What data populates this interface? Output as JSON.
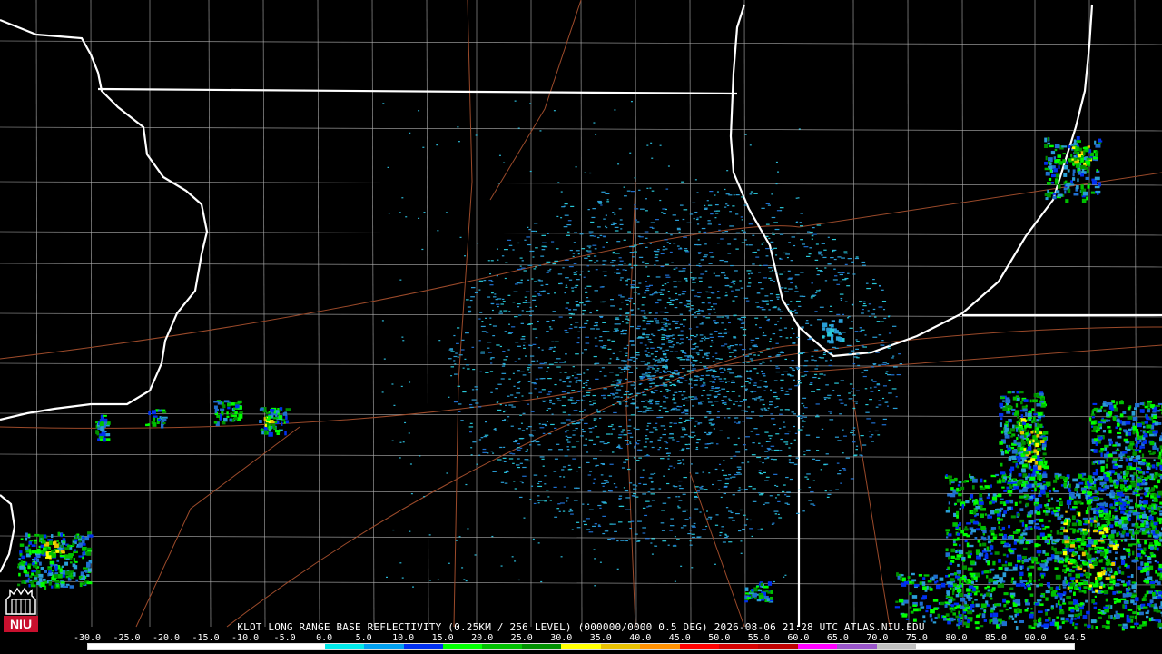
{
  "caption": {
    "radar": "KLOT LONG RANGE BASE REFLECTIVITY",
    "resolution": "(0.25KM / 256 LEVEL)",
    "volume": "(000000/0000 0.5 DEG)",
    "timestamp": "2026-08-06 21:28 UTC",
    "source": "ATLAS.NIU.EDU"
  },
  "logo": {
    "text": "NIU",
    "color": "#c8102e"
  },
  "legend": {
    "labels": [
      "-30.0",
      "-25.0",
      "-20.0",
      "-15.0",
      "-10.0",
      "-5.0",
      "0.0",
      "5.0",
      "10.0",
      "15.0",
      "20.0",
      "25.0",
      "30.0",
      "35.0",
      "40.0",
      "45.0",
      "50.0",
      "55.0",
      "60.0",
      "65.0",
      "70.0",
      "75.0",
      "80.0",
      "85.0",
      "90.0",
      "94.5"
    ],
    "colors": [
      "#ffffff",
      "#ffffff",
      "#ffffff",
      "#ffffff",
      "#ffffff",
      "#ffffff",
      "#00e8e8",
      "#00a0f0",
      "#0030f0",
      "#00ff00",
      "#00c000",
      "#009000",
      "#ffff00",
      "#e7c000",
      "#ff9000",
      "#ff0000",
      "#d60000",
      "#c00000",
      "#ff00ff",
      "#9955c9",
      "#c0c0c0",
      "#ffffff",
      "#ffffff",
      "#ffffff",
      "#ffffff"
    ]
  },
  "map_colors": {
    "state_border": "#ffffff",
    "county_line": "#b0b0b0",
    "road": "#9b4a2a",
    "background": "#000000"
  }
}
